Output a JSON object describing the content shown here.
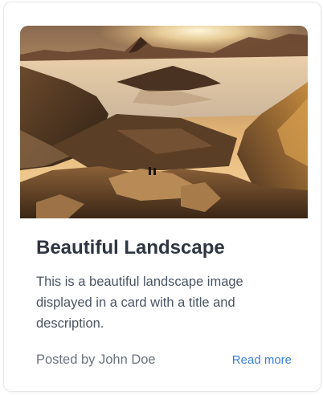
{
  "card": {
    "image_alt": "landscape-photo",
    "title": "Beautiful Landscape",
    "description": "This is a beautiful landscape image displayed in a card with a title and description.",
    "author_line": "Posted by John Doe",
    "read_more_label": "Read more"
  },
  "colors": {
    "title": "#2f3542",
    "body_text": "#4b5563",
    "muted_text": "#6b7280",
    "link": "#3b7ddd",
    "border": "#e5e7eb"
  }
}
